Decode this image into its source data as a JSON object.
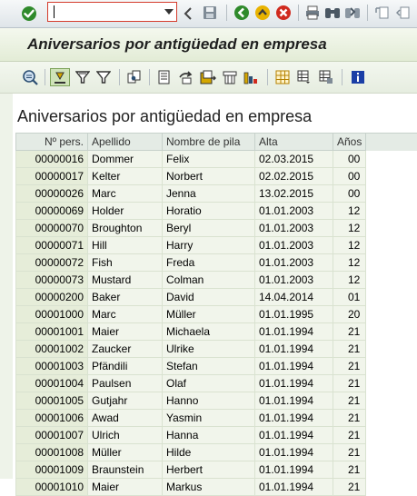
{
  "system_toolbar": {
    "command_field": {
      "value": "",
      "placeholder": ""
    },
    "icons": [
      "check-icon",
      "back-icon",
      "save-icon",
      "back-green-icon",
      "exit-icon",
      "cancel-icon",
      "print-icon",
      "find-icon",
      "find-next-icon",
      "first-page-icon",
      "prev-page-icon"
    ]
  },
  "title": "Aniversarios por antigüedad en empresa",
  "app_toolbar": {
    "icons": [
      "details-icon",
      "select-icon",
      "filter-icon",
      "filter-funnel-icon",
      "change-layout-icon",
      "print-preview-icon",
      "export-icon",
      "local-file-icon",
      "mail-icon",
      "abc-analysis-icon",
      "layout-grid-icon",
      "layout-choose-icon",
      "layout-save-icon",
      "info-icon"
    ]
  },
  "list_title": "Aniversarios por antigüedad en empresa",
  "table": {
    "columns": [
      "Nº pers.",
      "Apellido",
      "Nombre de pila",
      "Alta",
      "Años"
    ],
    "rows": [
      [
        "00000016",
        "Dommer",
        "Felix",
        "02.03.2015",
        "00"
      ],
      [
        "00000017",
        "Kelter",
        "Norbert",
        "02.02.2015",
        "00"
      ],
      [
        "00000026",
        "Marc",
        "Jenna",
        "13.02.2015",
        "00"
      ],
      [
        "00000069",
        "Holder",
        "Horatio",
        "01.01.2003",
        "12"
      ],
      [
        "00000070",
        "Broughton",
        "Beryl",
        "01.01.2003",
        "12"
      ],
      [
        "00000071",
        "Hill",
        "Harry",
        "01.01.2003",
        "12"
      ],
      [
        "00000072",
        "Fish",
        "Freda",
        "01.01.2003",
        "12"
      ],
      [
        "00000073",
        "Mustard",
        "Colman",
        "01.01.2003",
        "12"
      ],
      [
        "00000200",
        "Baker",
        "David",
        "14.04.2014",
        "01"
      ],
      [
        "00001000",
        "Marc",
        "Müller",
        "01.01.1995",
        "20"
      ],
      [
        "00001001",
        "Maier",
        "Michaela",
        "01.01.1994",
        "21"
      ],
      [
        "00001002",
        "Zaucker",
        "Ulrike",
        "01.01.1994",
        "21"
      ],
      [
        "00001003",
        "Pfändili",
        "Stefan",
        "01.01.1994",
        "21"
      ],
      [
        "00001004",
        "Paulsen",
        "Olaf",
        "01.01.1994",
        "21"
      ],
      [
        "00001005",
        "Gutjahr",
        "Hanno",
        "01.01.1994",
        "21"
      ],
      [
        "00001006",
        "Awad",
        "Yasmin",
        "01.01.1994",
        "21"
      ],
      [
        "00001007",
        "Ulrich",
        "Hanna",
        "01.01.1994",
        "21"
      ],
      [
        "00001008",
        "Müller",
        "Hilde",
        "01.01.1994",
        "21"
      ],
      [
        "00001009",
        "Braunstein",
        "Herbert",
        "01.01.1994",
        "21"
      ],
      [
        "00001010",
        "Maier",
        "Markus",
        "01.01.1994",
        "21"
      ]
    ]
  }
}
